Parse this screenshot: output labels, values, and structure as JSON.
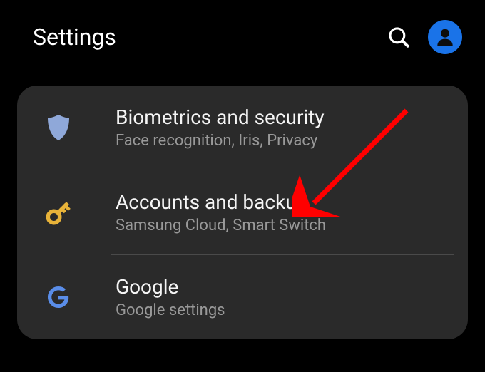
{
  "header": {
    "title": "Settings"
  },
  "items": [
    {
      "icon": "shield",
      "title": "Biometrics and security",
      "subtitle": "Face recognition, Iris, Privacy"
    },
    {
      "icon": "key",
      "title": "Accounts and backup",
      "subtitle": "Samsung Cloud, Smart Switch"
    },
    {
      "icon": "google",
      "title": "Google",
      "subtitle": "Google settings"
    }
  ]
}
